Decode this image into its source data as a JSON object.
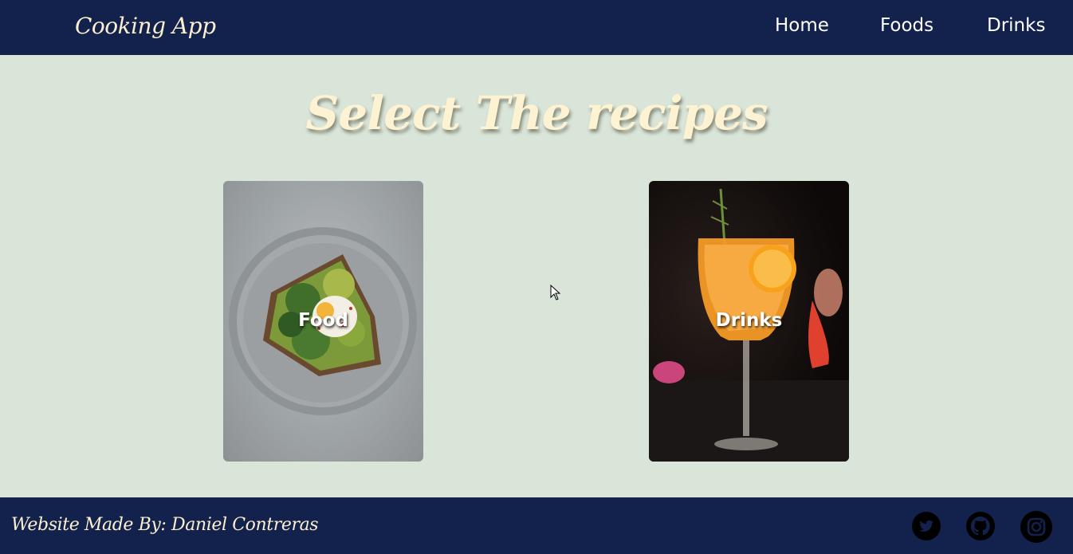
{
  "navbar": {
    "brand": "Cooking App",
    "links": [
      "Home",
      "Foods",
      "Drinks"
    ]
  },
  "main": {
    "heading": "Select The recipes",
    "cards": [
      {
        "label": "Food",
        "image": "avocado-toast-plate"
      },
      {
        "label": "Drinks",
        "image": "orange-cocktail-glass"
      }
    ]
  },
  "footer": {
    "credit": "Website Made By: Daniel Contreras",
    "social_icons": [
      "twitter-icon",
      "github-icon",
      "instagram-icon"
    ]
  },
  "colors": {
    "navbar": "#13214d",
    "background": "#dae5d9",
    "heading": "#fdf3d2",
    "brand_text": "#fbefcf"
  }
}
